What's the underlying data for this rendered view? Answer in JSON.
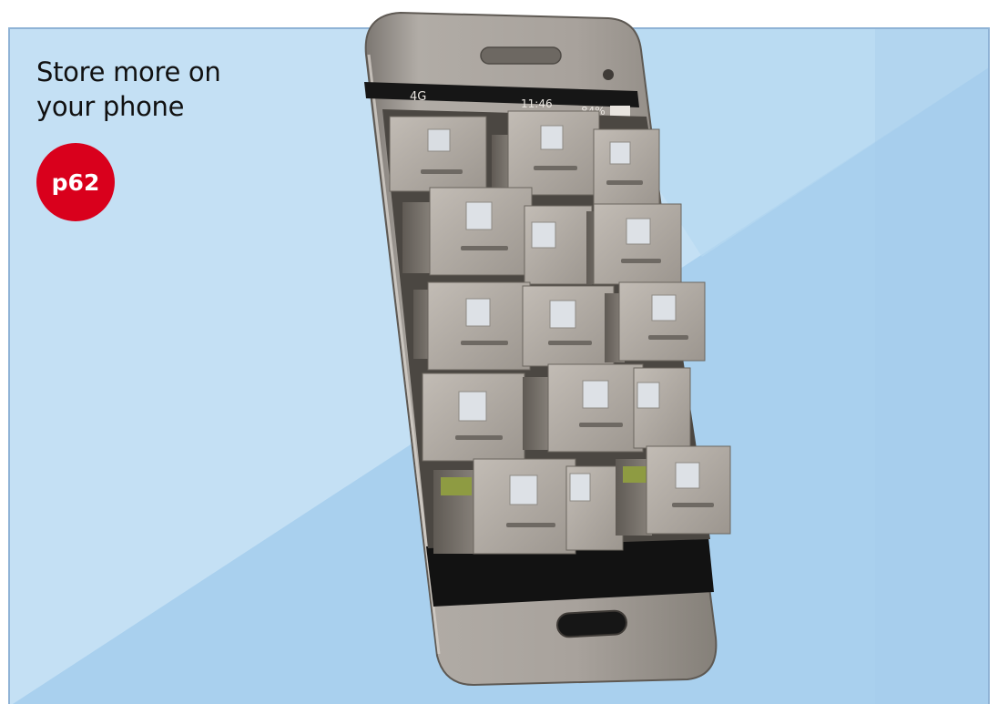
{
  "headline": {
    "line1": "Store more on",
    "line2": "your phone"
  },
  "badge": {
    "label": "p62",
    "color": "#d9001c"
  },
  "status_bar": {
    "network": "4G",
    "time": "11:46",
    "battery": "84%"
  },
  "colors": {
    "background_light": "#c4e0f4",
    "background_mid": "#a9d0ee",
    "phone_body": "#a39d97",
    "screen_dark": "#121212"
  }
}
